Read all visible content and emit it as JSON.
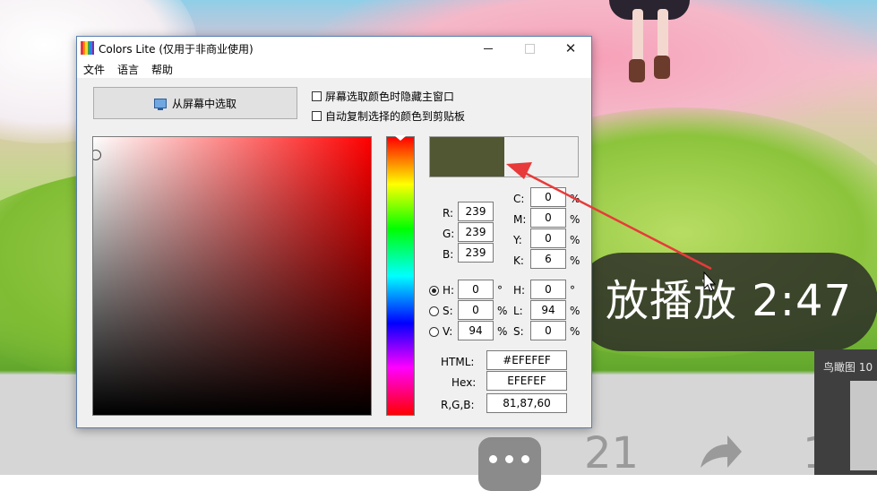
{
  "window": {
    "title": "Colors Lite (仅用于非商业使用)",
    "icon_name": "colors-lite-app-icon",
    "controls": {
      "minimize": "minimize-icon",
      "maximize": "maximize-icon",
      "close": "close-icon"
    }
  },
  "menu": {
    "file": "文件",
    "language": "语言",
    "help": "帮助"
  },
  "pick_button": {
    "label": "从屏幕中选取",
    "icon": "monitor-icon"
  },
  "options": {
    "hide_main_window": {
      "label": "屏幕选取颜色时隐藏主窗口",
      "checked": false
    },
    "auto_copy": {
      "label": "自动复制选择的颜色到剪贴板",
      "checked": false
    }
  },
  "colors": {
    "current": "#515733",
    "previous": "#EFEFEF",
    "hue_square": "#FF0000"
  },
  "rgb": {
    "r_label": "R:",
    "g_label": "G:",
    "b_label": "B:",
    "r": "239",
    "g": "239",
    "b": "239"
  },
  "cmyk": {
    "c_label": "C:",
    "m_label": "M:",
    "y_label": "Y:",
    "k_label": "K:",
    "c": "0",
    "m": "0",
    "y": "0",
    "k": "6",
    "unit": "%"
  },
  "hsv": {
    "h_label": "H:",
    "s_label": "S:",
    "v_label": "V:",
    "h": "0",
    "s": "0",
    "v": "94",
    "deg": "°",
    "unit": "%",
    "selected": "H"
  },
  "hsl": {
    "h_label": "H:",
    "l_label": "L:",
    "s_label": "S:",
    "h": "0",
    "l": "94",
    "s": "0",
    "deg": "°",
    "unit": "%"
  },
  "codes": {
    "html_label": "HTML:",
    "html": "#EFEFEF",
    "hex_label": "Hex:",
    "hex": "EFEFEF",
    "rgb_label": "R,G,B:",
    "rgb": "81,87,60"
  },
  "background": {
    "video_overlay": "放播放 2:47",
    "count": "21",
    "partial_digit": "1",
    "birdseye_label": "鸟瞰图 10"
  }
}
